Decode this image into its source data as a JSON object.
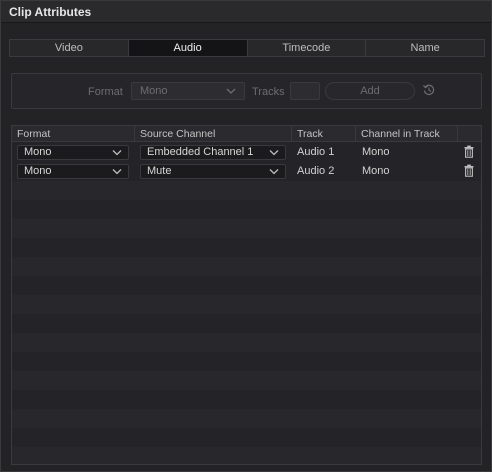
{
  "window": {
    "title": "Clip Attributes"
  },
  "tabs": [
    {
      "label": "Video",
      "active": false
    },
    {
      "label": "Audio",
      "active": true
    },
    {
      "label": "Timecode",
      "active": false
    },
    {
      "label": "Name",
      "active": false
    }
  ],
  "add_panel": {
    "format_label": "Format",
    "format_value": "Mono",
    "tracks_label": "Tracks",
    "tracks_value": "",
    "add_label": "Add",
    "reset_icon": "reset-icon"
  },
  "table": {
    "columns": [
      "Format",
      "Source Channel",
      "Track",
      "Channel in Track"
    ],
    "rows": [
      {
        "format": "Mono",
        "source_channel": "Embedded Channel 1",
        "track": "Audio 1",
        "channel_in_track": "Mono"
      },
      {
        "format": "Mono",
        "source_channel": "Mute",
        "track": "Audio 2",
        "channel_in_track": "Mono"
      }
    ]
  },
  "colors": {
    "background": "#232326",
    "active_tab": "#141416",
    "stripe": "#28282c"
  }
}
